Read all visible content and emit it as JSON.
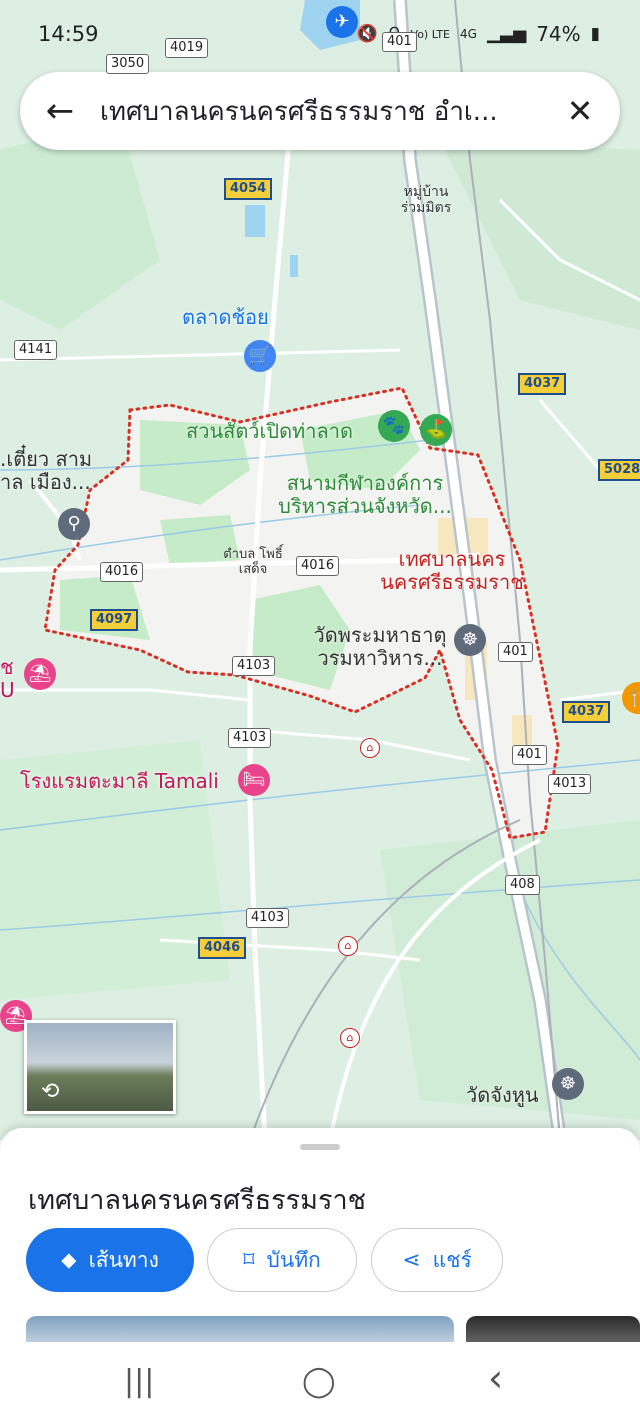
{
  "status_bar": {
    "time": "14:59",
    "battery": "74%",
    "network": "4G",
    "volte": "Vo) LTE"
  },
  "search": {
    "query": "เทศบาลนครนครศรีธรรมราช อำเ...",
    "back_icon": "arrow-left-icon",
    "close_icon": "close-icon"
  },
  "map": {
    "route_shields": [
      {
        "id": "r4019",
        "label": "4019",
        "style": "white"
      },
      {
        "id": "r3050",
        "label": "3050",
        "style": "white"
      },
      {
        "id": "r401a",
        "label": "401",
        "style": "white"
      },
      {
        "id": "r4054",
        "label": "4054",
        "style": "yellow"
      },
      {
        "id": "r4141",
        "label": "4141",
        "style": "white"
      },
      {
        "id": "r4037a",
        "label": "4037",
        "style": "yellow"
      },
      {
        "id": "r5028",
        "label": "5028",
        "style": "yellow"
      },
      {
        "id": "r4016a",
        "label": "4016",
        "style": "white"
      },
      {
        "id": "r4016b",
        "label": "4016",
        "style": "white"
      },
      {
        "id": "r4097",
        "label": "4097",
        "style": "yellow"
      },
      {
        "id": "r4103a",
        "label": "4103",
        "style": "white"
      },
      {
        "id": "r401b",
        "label": "401",
        "style": "white"
      },
      {
        "id": "r4037b",
        "label": "4037",
        "style": "yellow"
      },
      {
        "id": "r4103b",
        "label": "4103",
        "style": "white"
      },
      {
        "id": "r401c",
        "label": "401",
        "style": "white"
      },
      {
        "id": "r4013",
        "label": "4013",
        "style": "white"
      },
      {
        "id": "r408",
        "label": "408",
        "style": "white"
      },
      {
        "id": "r4103c",
        "label": "4103",
        "style": "white"
      },
      {
        "id": "r4046",
        "label": "4046",
        "style": "yellow"
      }
    ],
    "labels": {
      "village": "หมู่บ้าน ร่วมมิตร",
      "market": "ตลาดช้อย",
      "zoo": "สวนสัตว์เปิดท่าลาด",
      "stadium": "สนามกีฬาองค์การ บริหารส่วนจังหวัด...",
      "municipality": "เทศบาลนคร นครศรีธรรมราช",
      "subdistrict": "ตำบล โพธิ์เสด็จ",
      "temple": "วัดพระมหาธาตุ วรมหาวิหาร...",
      "left_place": ".เตี๋ยว สาม าล เมือง...",
      "left_place2": "ช U",
      "hotel": "โรงแรมตะมาลี Tamali",
      "temple2": "วัดจังหูน"
    },
    "colors": {
      "land": "#dcefe2",
      "boundary": "#d93025",
      "city_fill": "#f3f4f1",
      "park": "#c6ebc8",
      "road": "#ffffff",
      "water": "#9fd4f0"
    }
  },
  "bottom_sheet": {
    "title": "เทศบาลนครนครศรีธรรมราช",
    "buttons": [
      {
        "label": "เส้นทาง",
        "icon": "directions-icon"
      },
      {
        "label": "บันทึก",
        "icon": "bookmark-icon"
      },
      {
        "label": "แชร์",
        "icon": "share-icon"
      }
    ]
  },
  "nav_bar": {
    "recents": "|||",
    "home": "◯",
    "back": "‹"
  }
}
